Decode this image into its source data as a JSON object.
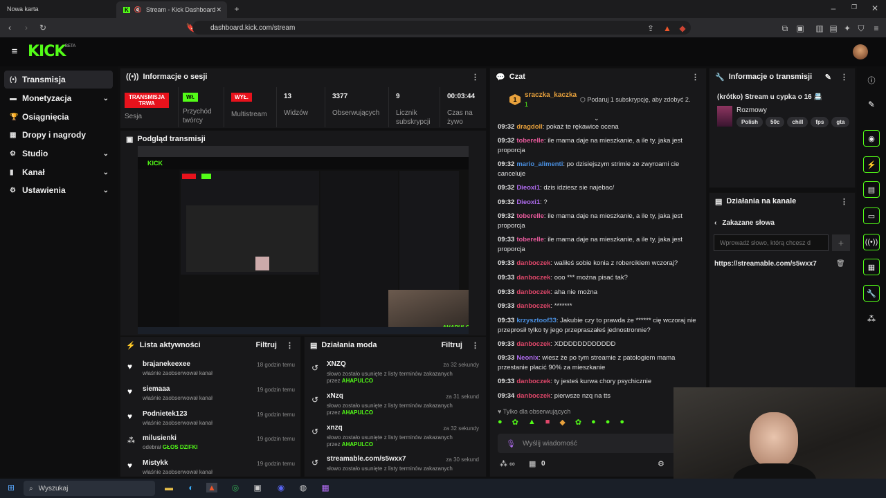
{
  "browser": {
    "tabs": [
      "Nowa karta",
      "Stream - Kick Dashboard"
    ],
    "url": "dashboard.kick.com/stream"
  },
  "app": {
    "logo": "KICK",
    "beta": "BETA"
  },
  "sidebar": {
    "items": [
      {
        "label": "Transmisja",
        "icon": "broadcast-icon"
      },
      {
        "label": "Monetyzacja",
        "icon": "money-icon"
      },
      {
        "label": "Osiągnięcia",
        "icon": "trophy-icon"
      },
      {
        "label": "Dropy i nagrody",
        "icon": "gift-icon"
      },
      {
        "label": "Studio",
        "icon": "studio-icon"
      },
      {
        "label": "Kanał",
        "icon": "channel-icon"
      },
      {
        "label": "Ustawienia",
        "icon": "gear-icon"
      }
    ]
  },
  "session": {
    "title": "Informacje o sesji",
    "stats": [
      {
        "badge": "TRANSMISJA TRWA",
        "label": "Sesja"
      },
      {
        "badge": "Wł.",
        "label": "Przychód twórcy"
      },
      {
        "badge": "WYŁ.",
        "label": "Multistream"
      },
      {
        "value": "13",
        "label": "Widzów"
      },
      {
        "value": "3377",
        "label": "Obserwujących"
      },
      {
        "value": "9",
        "label": "Licznik subskrypcji"
      },
      {
        "value": "00:03:44",
        "label": "Czas na żywo"
      }
    ]
  },
  "preview": {
    "title": "Podgląd transmisji"
  },
  "activity": {
    "title": "Lista aktywności",
    "filter": "Filtruj",
    "items": [
      {
        "name": "brajanekeexee",
        "sub": "właśnie zaobserwował kanał",
        "time": "18 godzin temu"
      },
      {
        "name": "siemaaa",
        "sub": "właśnie zaobserwował kanał",
        "time": "19 godzin temu"
      },
      {
        "name": "Podnietek123",
        "sub": "właśnie zaobserwował kanał",
        "time": "19 godzin temu"
      },
      {
        "name": "milusienki",
        "sub": "odebrał",
        "sub2": "GŁOS DZIFKI",
        "time": "19 godzin temu"
      },
      {
        "name": "Mistykk",
        "sub": "właśnie zaobserwował kanał",
        "time": "19 godzin temu"
      }
    ]
  },
  "mod": {
    "title": "Działania moda",
    "filter": "Filtruj",
    "items": [
      {
        "name": "XNZQ",
        "time": "za 32 sekundy",
        "sub": "słowo zostało usunięte z listy terminów zakazanych",
        "by": "przez",
        "mod": "AHAPULCO"
      },
      {
        "name": "xNzq",
        "time": "za 31 sekund",
        "sub": "słowo zostało usunięte z listy terminów zakazanych",
        "by": "przez",
        "mod": "AHAPULCO"
      },
      {
        "name": "xnzq",
        "time": "za 32 sekundy",
        "sub": "słowo zostało usunięte z listy terminów zakazanych",
        "by": "przez",
        "mod": "AHAPULCO"
      },
      {
        "name": "streamable.com/s5wxx7",
        "time": "za 30 sekund",
        "sub": "słowo zostało usunięte z listy terminów zakazanych",
        "by": "przez",
        "mod": "AHAPULCO"
      }
    ]
  },
  "chat": {
    "title": "Czat",
    "top_user": "sraczka_kaczka",
    "top_count": "1",
    "gift_prompt": "Podaruj 1 subskrypcję, aby zdobyć 2.",
    "messages": [
      {
        "time": "09:32",
        "user": "dragdoll",
        "color": "#e8a13c",
        "text": ": pokaż te rękawice ocena"
      },
      {
        "time": "09:32",
        "user": "toberelle",
        "color": "#e85a9c",
        "text": ": ile mama daje na mieszkanie, a ile ty, jaka jest proporcja"
      },
      {
        "time": "09:32",
        "user": "mario_alimenti",
        "color": "#4a90e2",
        "text": ": po dzisiejszym strimie ze zwyroami cie canceluje"
      },
      {
        "time": "09:32",
        "user": "Dieoxi1",
        "color": "#b06cf0",
        "text": ": dzis idziesz sie najebac/"
      },
      {
        "time": "09:32",
        "user": "Dieoxi1",
        "color": "#b06cf0",
        "text": ": ?"
      },
      {
        "time": "09:32",
        "user": "toberelle",
        "color": "#e85a9c",
        "text": ": ile mama daje na mieszkanie, a ile ty, jaka jest proporcja"
      },
      {
        "time": "09:33",
        "user": "toberelle",
        "color": "#e85a9c",
        "text": ": ile mama daje na mieszkanie, a ile ty, jaka jest proporcja"
      },
      {
        "time": "09:33",
        "user": "danboczek",
        "color": "#e0476a",
        "text": ": waliłeś sobie konia z robercikiem wczoraj?"
      },
      {
        "time": "09:33",
        "user": "danboczek",
        "color": "#e0476a",
        "text": ": ooo *** można pisać tak?"
      },
      {
        "time": "09:33",
        "user": "danboczek",
        "color": "#e0476a",
        "text": ": aha nie można"
      },
      {
        "time": "09:33",
        "user": "danboczek",
        "color": "#e0476a",
        "text": ": *******"
      },
      {
        "time": "09:33",
        "user": "krzysztoof33",
        "color": "#4a90e2",
        "text": ": Jakubie czy to prawda że ****** cię wczoraj nie przeprosił tylko ty jego przepraszałeś jednostronnie?"
      },
      {
        "time": "09:33",
        "user": "danboczek",
        "color": "#e0476a",
        "text": ": XDDDDDDDDDDDD"
      },
      {
        "time": "09:33",
        "user": "Neonix",
        "color": "#b06cf0",
        "text": ": wiesz że po tym streamie z patologiem mama przestanie płacić 90% za mieszkanie"
      },
      {
        "time": "09:33",
        "user": "danboczek",
        "color": "#e0476a",
        "text": ": ty jesteś kurwa chory psychicznie"
      },
      {
        "time": "09:34",
        "user": "danboczek",
        "color": "#e0476a",
        "text": ": pierwsze nzq na tts"
      }
    ],
    "followers_only": "Tylko dla obserwujących",
    "placeholder": "Wyślij wiadomość",
    "points": "0"
  },
  "stream_info": {
    "title": "Informacje o transmisji",
    "stream_title": "(krótko) Stream u cypka o 16 📇",
    "category": "Rozmowy",
    "tags": [
      "Polish",
      "50c",
      "chill",
      "fps",
      "gta"
    ]
  },
  "channel_actions": {
    "title": "Działania na kanale",
    "section": "Zakazane słowa",
    "placeholder": "Wprowadź słowo, którą chcesz d",
    "word": "https://streamable.com/s5wxx7"
  },
  "taskbar": {
    "search": "Wyszukaj"
  },
  "overlay": {
    "watermark": "AHAPULCO"
  },
  "colors": {
    "accent": "#53fc18",
    "live": "#e8121c"
  }
}
